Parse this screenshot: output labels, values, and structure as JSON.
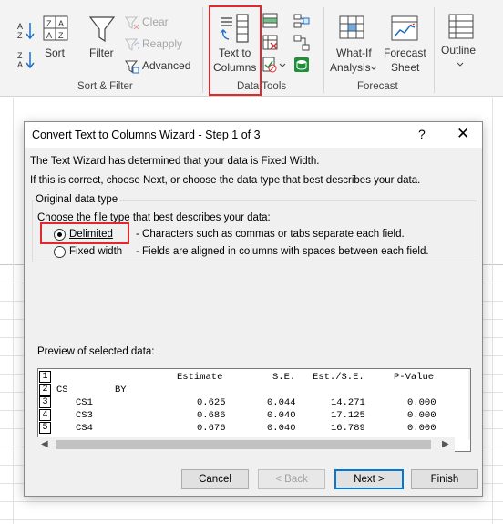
{
  "ribbon": {
    "sort_filter": {
      "sort_label": "Sort",
      "filter_label": "Filter",
      "clear_label": "Clear",
      "reapply_label": "Reapply",
      "advanced_label": "Advanced",
      "group_label": "Sort & Filter"
    },
    "data_tools": {
      "text_to_columns_line1": "Text to",
      "text_to_columns_line2": "Columns",
      "group_label": "Data Tools"
    },
    "forecast": {
      "whatif_line1": "What-If",
      "whatif_line2": "Analysis",
      "forecast_sheet_line1": "Forecast",
      "forecast_sheet_line2": "Sheet",
      "group_label": "Forecast"
    },
    "outline": {
      "label": "Outline"
    }
  },
  "dialog": {
    "title": "Convert Text to Columns Wizard - Step 1 of 3",
    "help_glyph": "?",
    "close_glyph": "✕",
    "intro_line1": "The Text Wizard has determined that your data is Fixed Width.",
    "intro_line2": "If this is correct, choose Next, or choose the data type that best describes your data.",
    "original_data_type_legend": "Original data type",
    "choose_prompt": "Choose the file type that best describes your data:",
    "options": [
      {
        "label": "Delimited",
        "description": "- Characters such as commas or tabs separate each field.",
        "checked": true
      },
      {
        "label": "Fixed width",
        "description": "- Fields are aligned in columns with spaces between each field.",
        "checked": false
      }
    ],
    "preview_label": "Preview of selected data:",
    "preview_rows": [
      {
        "num": "1",
        "c1": "",
        "c2": "",
        "c3": "Estimate",
        "c4": "S.E.",
        "c5": "Est./S.E.",
        "c6": "P-Value"
      },
      {
        "num": "2",
        "c1": "CS",
        "c2": "BY",
        "c3": "",
        "c4": "",
        "c5": "",
        "c6": ""
      },
      {
        "num": "3",
        "c1": "",
        "c2": "CS1",
        "c3": "0.625",
        "c4": "0.044",
        "c5": "14.271",
        "c6": "0.000"
      },
      {
        "num": "4",
        "c1": "",
        "c2": "CS3",
        "c3": "0.686",
        "c4": "0.040",
        "c5": "17.125",
        "c6": "0.000"
      },
      {
        "num": "5",
        "c1": "",
        "c2": "CS4",
        "c3": "0.676",
        "c4": "0.040",
        "c5": "16.789",
        "c6": "0.000"
      }
    ],
    "buttons": {
      "cancel": "Cancel",
      "back": "< Back",
      "next": "Next >",
      "finish": "Finish"
    }
  }
}
